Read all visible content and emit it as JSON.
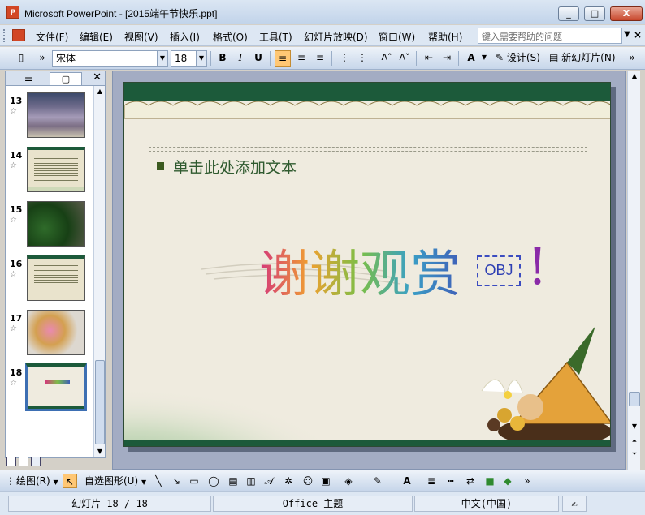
{
  "window": {
    "title": "Microsoft PowerPoint - [2015端午节快乐.ppt]",
    "app_icon_label": "P",
    "minimize": "_",
    "restore": "□",
    "close": "X"
  },
  "menubar": {
    "items": [
      "文件(F)",
      "编辑(E)",
      "视图(V)",
      "插入(I)",
      "格式(O)",
      "工具(T)",
      "幻灯片放映(D)",
      "窗口(W)",
      "帮助(H)"
    ],
    "help_placeholder": "键入需要帮助的问题",
    "help_arrow": "▼",
    "close_doc": "×"
  },
  "toolbar": {
    "font_name": "宋体",
    "font_size": "18",
    "bold": "B",
    "italic": "I",
    "underline": "U",
    "font_color": "A",
    "design_label": "设计(S)",
    "new_slide_label": "新幻灯片(N)",
    "align_left_active": true
  },
  "panel": {
    "tab_outline": "☰",
    "tab_slides": "▢",
    "close": "✕",
    "slides": [
      {
        "number": "13",
        "star": "☆",
        "thumb": "people"
      },
      {
        "number": "14",
        "star": "☆",
        "thumb": "text"
      },
      {
        "number": "15",
        "star": "☆",
        "thumb": "plants"
      },
      {
        "number": "16",
        "star": "☆",
        "thumb": "text"
      },
      {
        "number": "17",
        "star": "☆",
        "thumb": "pink"
      },
      {
        "number": "18",
        "star": "☆",
        "thumb": "current",
        "selected": true
      }
    ]
  },
  "slide": {
    "bullet_text": "单击此处添加文本",
    "thanks_text": "谢谢观赏",
    "obj_label": "OBJ",
    "exclaim": "!"
  },
  "drawbar": {
    "draw_label": "绘图(R)",
    "autoshape_label": "自选图形(U)"
  },
  "status": {
    "slide_info": "幻灯片 18 / 18",
    "theme": "Office 主题",
    "language": "中文(中国)"
  },
  "colors": {
    "slide_green": "#1c5a3a",
    "slide_bg": "#efebdf",
    "text_green": "#2f5a2f",
    "accent_blue": "#3d6fb3"
  }
}
